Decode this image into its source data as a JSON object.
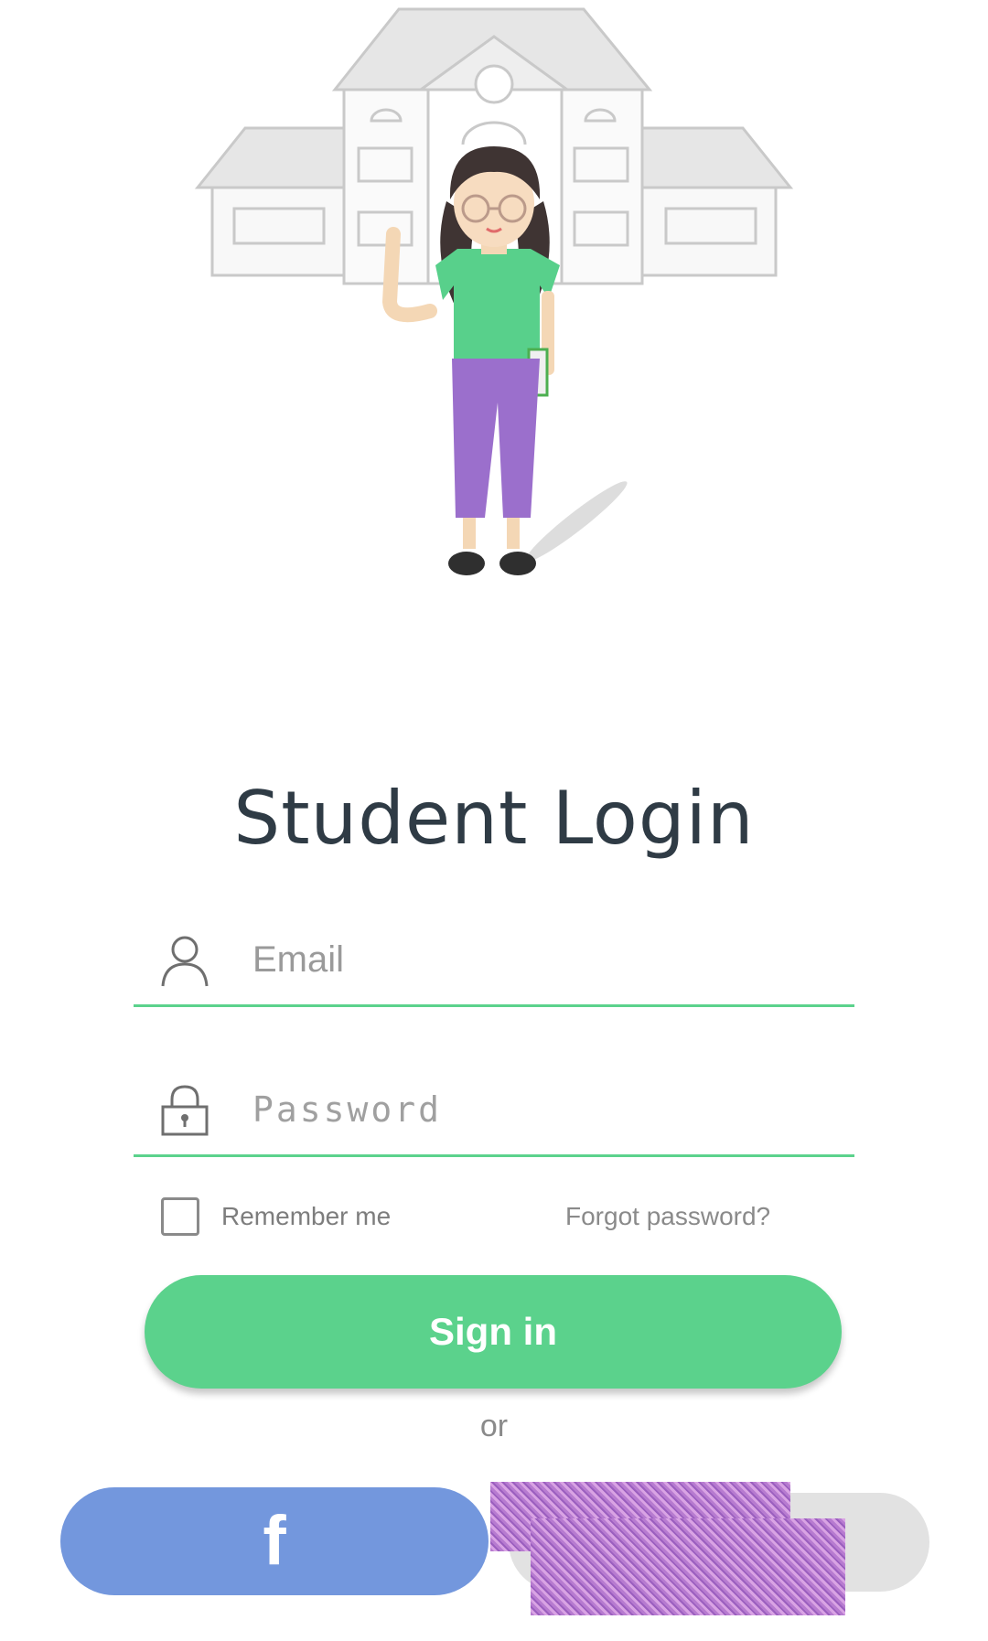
{
  "title": "Student Login",
  "form": {
    "email_placeholder": "Email",
    "password_placeholder": "Password",
    "remember_label": "Remember me",
    "remember_checked": false,
    "forgot_label": "Forgot password?"
  },
  "actions": {
    "signin_label": "Sign in",
    "or_label": "or",
    "facebook_glyph": "f"
  },
  "colors": {
    "accent": "#5bd28c",
    "facebook": "#7397dd",
    "title": "#2f3b45"
  },
  "icons": {
    "email": "user-icon",
    "password": "lock-icon"
  }
}
